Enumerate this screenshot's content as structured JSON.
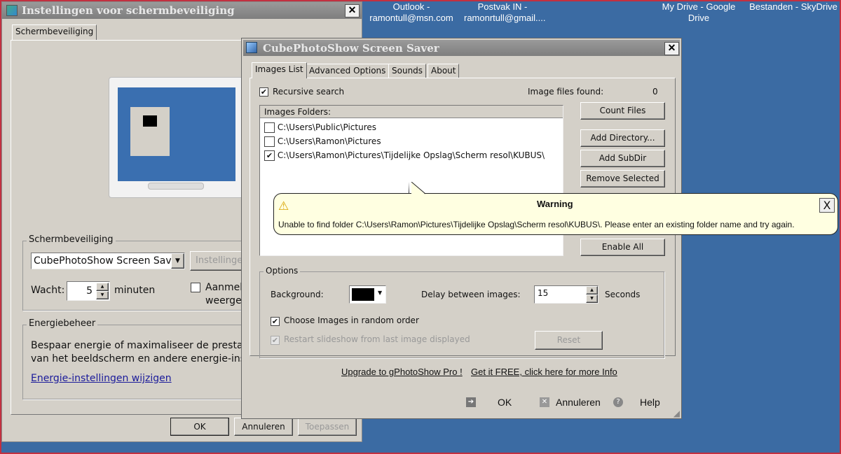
{
  "desktop": {
    "icons": [
      {
        "label": "Outlook - ramontull@msn.com"
      },
      {
        "label": "Postvak IN - ramonrtull@gmail...."
      },
      {
        "label": "My Drive - Google Drive"
      },
      {
        "label": "Bestanden - SkyDrive"
      }
    ],
    "background": "#3b6ba3"
  },
  "settings_dialog": {
    "title": "Instellingen voor schermbeveiliging",
    "close": "✕",
    "tab": "Schermbeveiliging",
    "screensaver_group": {
      "legend": "Schermbeveiliging",
      "selected": "CubePhotoShow Screen Saver",
      "settings_button": "Instellingen...",
      "wait_label": "Wacht:",
      "wait_value": "5",
      "minutes": "minuten",
      "logon_label": "Aanmelden bij hervatten",
      "logon_label_2": "weergeven"
    },
    "energy_group": {
      "legend": "Energiebeheer",
      "text1": "Bespaar energie of maximaliseer de prestaties door de helderheid",
      "text2": "van het beeldscherm en andere energie-instellingen aan te passen.",
      "link": "Energie-instellingen wijzigen"
    },
    "buttons": {
      "ok": "OK",
      "cancel": "Annuleren",
      "apply": "Toepassen"
    }
  },
  "cube_dialog": {
    "title": "CubePhotoShow Screen Saver",
    "close": "✕",
    "tabs": [
      "Images List",
      "Advanced Options",
      "Sounds",
      "About"
    ],
    "recursive_label": "Recursive search",
    "recursive_checked": true,
    "found_label": "Image files found:",
    "found_value": "0",
    "list_header": "Images Folders:",
    "folders": [
      {
        "path": "C:\\Users\\Public\\Pictures",
        "checked": false
      },
      {
        "path": "C:\\Users\\Ramon\\Pictures",
        "checked": false
      },
      {
        "path": "C:\\Users\\Ramon\\Pictures\\Tijdelijke Opslag\\Scherm resol\\KUBUS\\",
        "checked": true
      }
    ],
    "buttons": {
      "count": "Count Files",
      "add_dir": "Add Directory...",
      "add_sub": "Add SubDir",
      "remove": "Remove Selected",
      "enable_all": "Enable All"
    },
    "options": {
      "legend": "Options",
      "background_label": "Background:",
      "background_color": "#000000",
      "delay_label": "Delay between images:",
      "delay_value": "15",
      "seconds": "Seconds",
      "random_label": "Choose Images in random order",
      "restart_label": "Restart slideshow from last image displayed",
      "reset": "Reset"
    },
    "links": {
      "upgrade": "Upgrade to gPhotoShow Pro !",
      "free": "Get it FREE, click here for more Info"
    },
    "footer": {
      "ok": "OK",
      "cancel": "Annuleren",
      "help": "Help"
    }
  },
  "warning": {
    "title": "Warning",
    "message": "Unable to find folder C:\\Users\\Ramon\\Pictures\\Tijdelijke Opslag\\Scherm resol\\KUBUS\\. Please enter an existing folder name and try again.",
    "close": "X"
  }
}
